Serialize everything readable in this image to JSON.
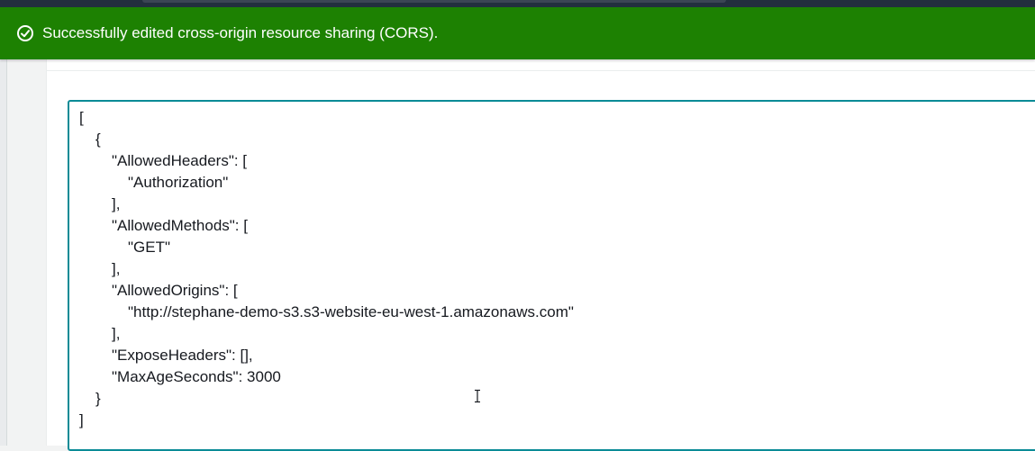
{
  "flash": {
    "message": "Successfully edited cross-origin resource sharing (CORS).",
    "icon": "check-circle-icon",
    "color": "#1d8102"
  },
  "editor": {
    "accent": "#0a8b96",
    "lines": [
      {
        "indent": 0,
        "text": "["
      },
      {
        "indent": 1,
        "text": "{"
      },
      {
        "indent": 2,
        "text": "\"AllowedHeaders\": ["
      },
      {
        "indent": 3,
        "text": "\"Authorization\""
      },
      {
        "indent": 2,
        "text": "],"
      },
      {
        "indent": 2,
        "text": "\"AllowedMethods\": ["
      },
      {
        "indent": 3,
        "text": "\"GET\""
      },
      {
        "indent": 2,
        "text": "],"
      },
      {
        "indent": 2,
        "text": "\"AllowedOrigins\": ["
      },
      {
        "indent": 3,
        "text": "\"http://stephane-demo-s3.s3-website-eu-west-1.amazonaws.com\""
      },
      {
        "indent": 2,
        "text": "],"
      },
      {
        "indent": 2,
        "text": "\"ExposeHeaders\": [],"
      },
      {
        "indent": 2,
        "text": "\"MaxAgeSeconds\": 3000"
      },
      {
        "indent": 1,
        "text": "}"
      },
      {
        "indent": 0,
        "text": "]"
      }
    ]
  }
}
